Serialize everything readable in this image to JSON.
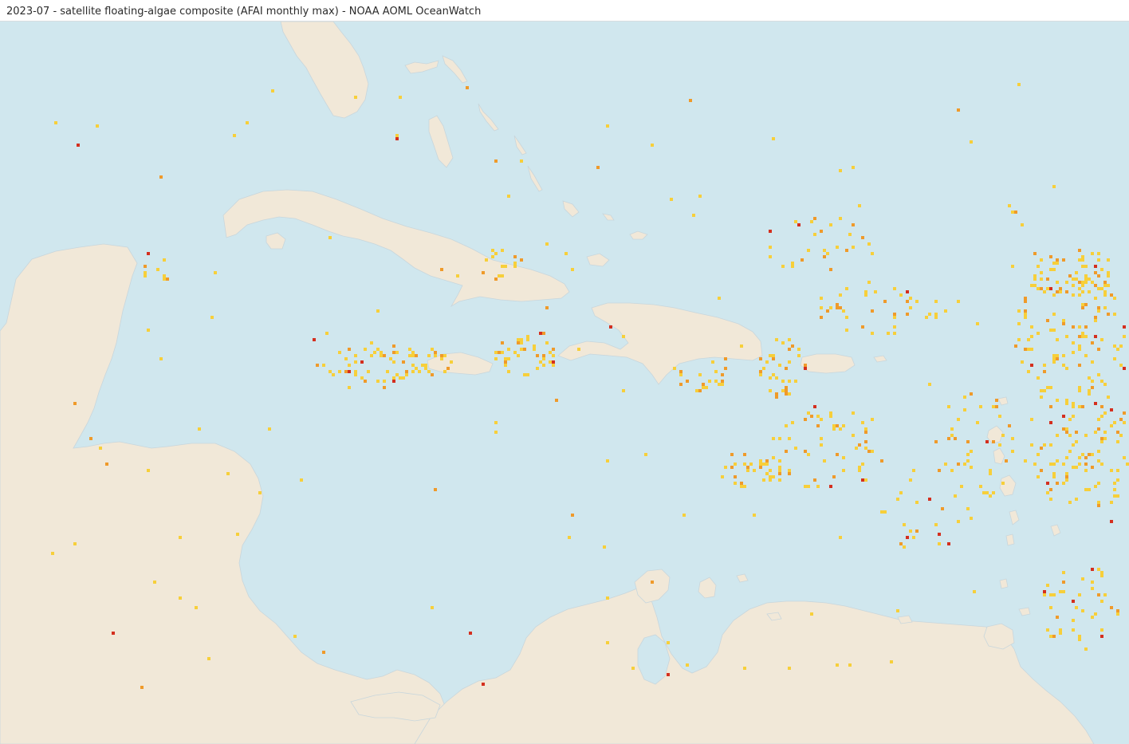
{
  "header": {
    "title": "2023-07 - satellite floating-algae composite (AFAI monthly max) - NOAA AOML OceanWatch"
  },
  "colors": {
    "ocean": "#d0e7ee",
    "land": "#f1e8d8",
    "coast": "#c8d6dc",
    "density_low": "#f7cf3a",
    "density_mid": "#ef9a2a",
    "density_high": "#d42f1e"
  },
  "map": {
    "region": "Caribbean Sea and Gulf of Mexico",
    "layer": "floating-algae (AFAI monthly max)",
    "density_classes": [
      "low",
      "mid",
      "high"
    ],
    "landmasses": [
      "Florida",
      "Bahamas",
      "Cuba",
      "Jamaica",
      "Hispaniola",
      "Puerto Rico",
      "Yucatan Peninsula",
      "Central America",
      "South America",
      "Trinidad",
      "Lesser Antilles"
    ]
  }
}
